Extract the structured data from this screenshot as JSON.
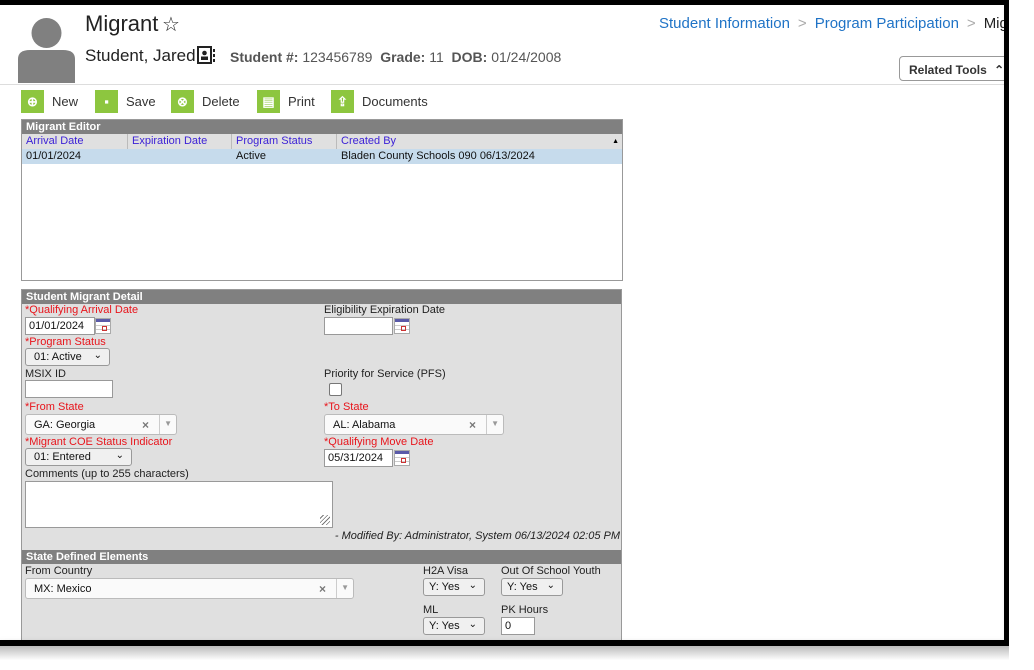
{
  "header": {
    "title": "Migrant",
    "student_name": "Student, Jared",
    "student_num_label": "Student #:",
    "student_num": "123456789",
    "grade_label": "Grade:",
    "grade": "11",
    "dob_label": "DOB:",
    "dob": "01/24/2008"
  },
  "breadcrumbs": [
    "Student Information",
    "Program Participation",
    "Migrant"
  ],
  "related_tools": "Related Tools",
  "toolbar": {
    "new": "New",
    "save": "Save",
    "delete": "Delete",
    "print": "Print",
    "documents": "Documents"
  },
  "editor": {
    "title": "Migrant Editor",
    "columns": [
      "Arrival Date",
      "Expiration Date",
      "Program Status",
      "Created By"
    ],
    "rows": [
      [
        "01/01/2024",
        "",
        "Active",
        "Bladen County Schools 090 06/13/2024"
      ]
    ]
  },
  "detail": {
    "title": "Student Migrant Detail",
    "qualifying_arrival_date": {
      "label": "Qualifying Arrival Date",
      "value": "01/01/2024"
    },
    "eligibility_expiration_date": {
      "label": "Eligibility Expiration Date",
      "value": ""
    },
    "program_status": {
      "label": "Program Status",
      "value": "01: Active"
    },
    "msix_id": {
      "label": "MSIX ID",
      "value": ""
    },
    "pfs": {
      "label": "Priority for Service (PFS)",
      "checked": false
    },
    "from_state": {
      "label": "From State",
      "value": "GA: Georgia"
    },
    "to_state": {
      "label": "To State",
      "value": "AL: Alabama"
    },
    "coe_status": {
      "label": "Migrant COE Status Indicator",
      "value": "01: Entered"
    },
    "qualifying_move_date": {
      "label": "Qualifying Move Date",
      "value": "05/31/2024"
    },
    "comments": {
      "label": "Comments (up to 255 characters)",
      "value": ""
    },
    "modified": "- Modified By: Administrator, System 06/13/2024 02:05 PM"
  },
  "state": {
    "title": "State Defined Elements",
    "from_country": {
      "label": "From Country",
      "value": "MX: Mexico"
    },
    "h2a_visa": {
      "label": "H2A Visa",
      "value": "Y: Yes"
    },
    "out_of_school_youth": {
      "label": "Out Of School Youth",
      "value": "Y: Yes"
    },
    "ml": {
      "label": "ML",
      "value": "Y: Yes"
    },
    "pk_hours": {
      "label": "PK Hours",
      "value": "0"
    }
  },
  "colors": {
    "toolbar_icon": "#8dc63f",
    "panel_header": "#808080",
    "required": "#e8141b",
    "link": "#1f73c6",
    "selected_row": "#c6dbec"
  }
}
